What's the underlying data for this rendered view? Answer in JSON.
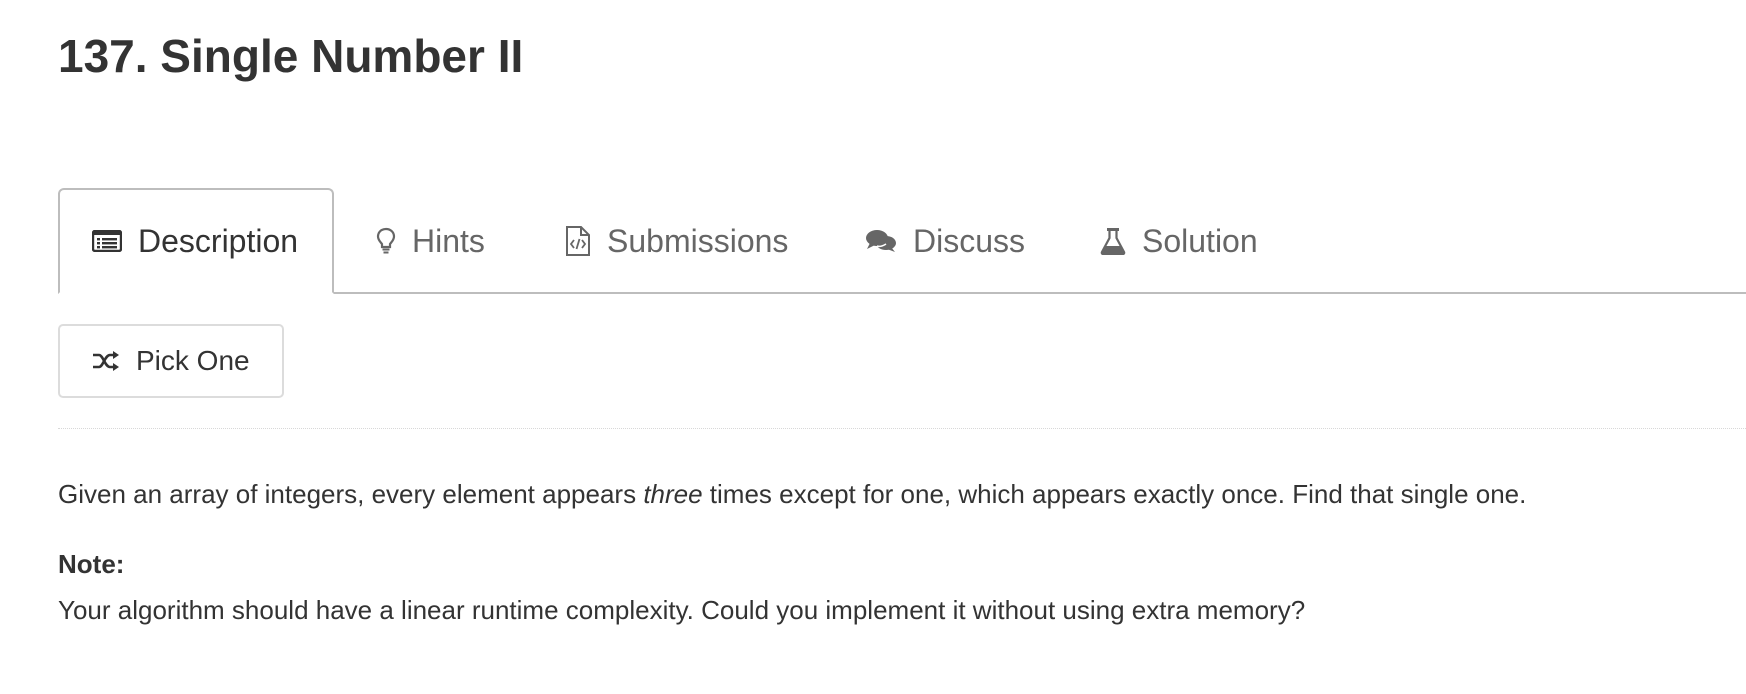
{
  "problem": {
    "title": "137. Single Number II"
  },
  "tabs": [
    {
      "label": "Description",
      "icon": "list-icon",
      "active": true
    },
    {
      "label": "Hints",
      "icon": "lightbulb-icon",
      "active": false
    },
    {
      "label": "Submissions",
      "icon": "code-file-icon",
      "active": false
    },
    {
      "label": "Discuss",
      "icon": "chat-bubbles-icon",
      "active": false
    },
    {
      "label": "Solution",
      "icon": "flask-icon",
      "active": false
    }
  ],
  "pick_one": {
    "label": "Pick One",
    "icon": "shuffle-icon"
  },
  "description": {
    "paragraph_1_before": "Given an array of integers, every element appears ",
    "paragraph_1_emphasis": "three",
    "paragraph_1_after": " times except for one, which appears exactly once. Find that single one.",
    "note_label": "Note:",
    "note_text": "Your algorithm should have a linear runtime complexity. Could you implement it without using extra memory?"
  },
  "colors": {
    "text": "#333333",
    "tab_inactive": "#666666",
    "border": "#bdbdbd"
  }
}
